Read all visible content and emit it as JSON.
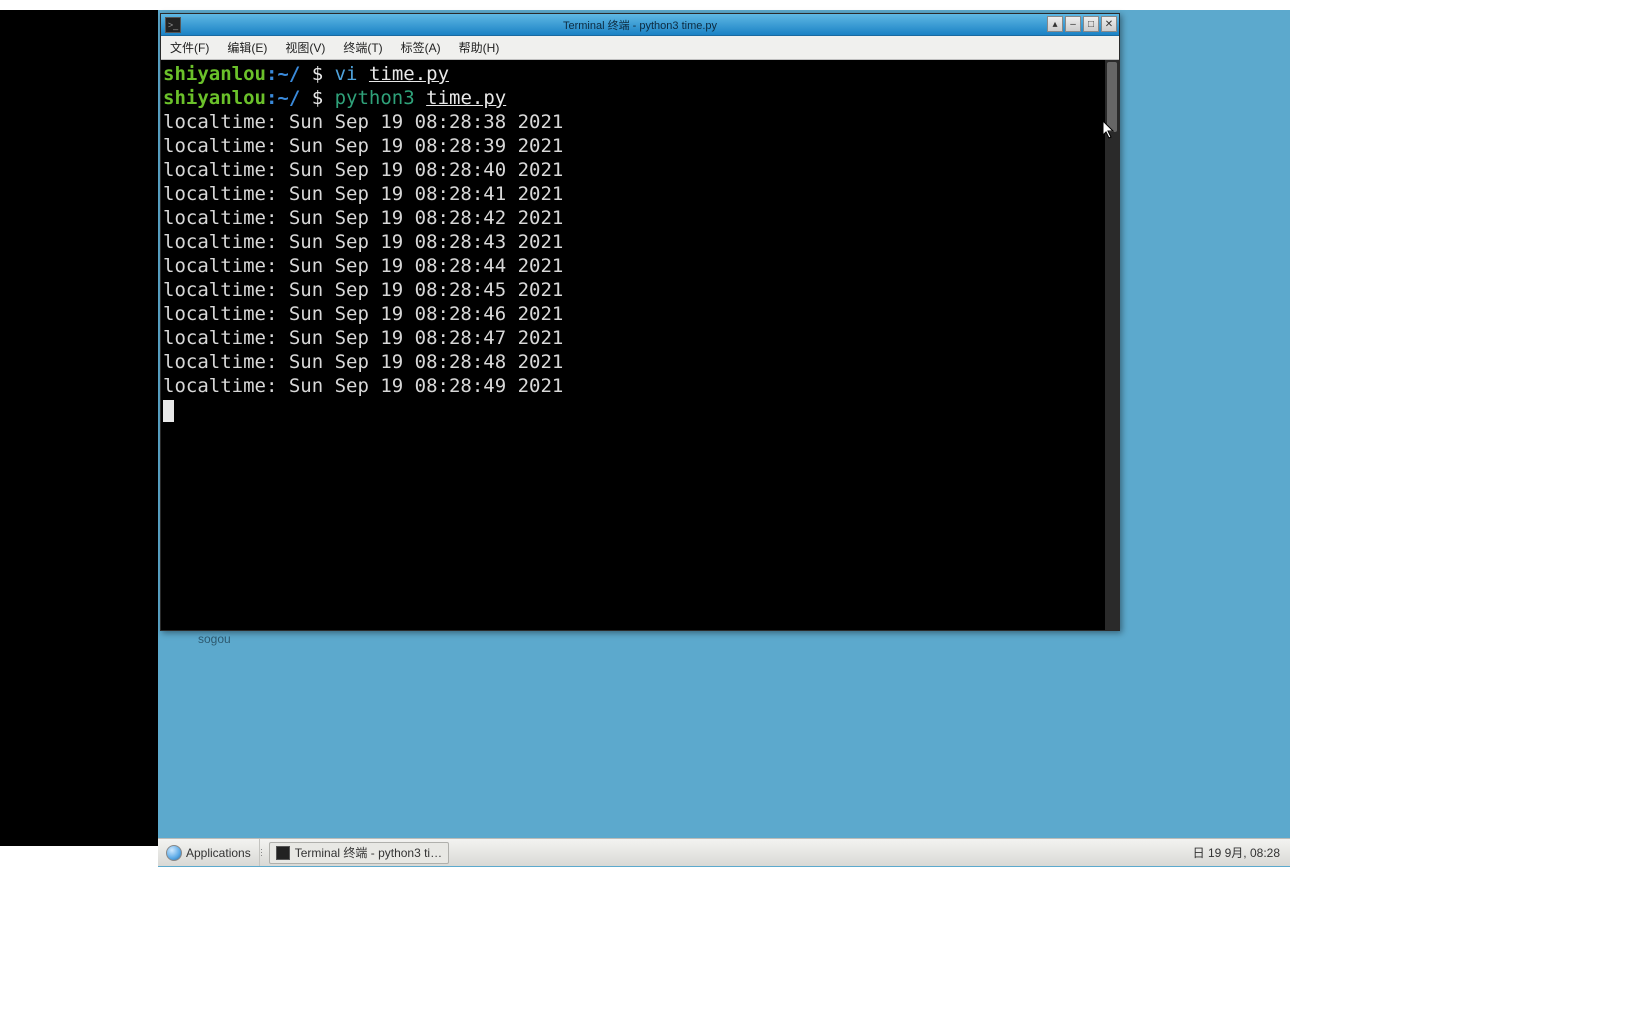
{
  "window": {
    "title": "Terminal 终端 - python3 time.py"
  },
  "menubar": {
    "file": "文件(F)",
    "edit": "编辑(E)",
    "view": "视图(V)",
    "terminal": "终端(T)",
    "tabs": "标签(A)",
    "help": "帮助(H)"
  },
  "prompt": {
    "user_host": "shiyanlou",
    "path": ":~/",
    "sep": " $ "
  },
  "commands": {
    "line1_cmd": "vi",
    "line1_arg": "time.py",
    "line2_cmd": "python3",
    "line2_arg": "time.py"
  },
  "output": [
    "localtime: Sun Sep 19 08:28:38 2021",
    "localtime: Sun Sep 19 08:28:39 2021",
    "localtime: Sun Sep 19 08:28:40 2021",
    "localtime: Sun Sep 19 08:28:41 2021",
    "localtime: Sun Sep 19 08:28:42 2021",
    "localtime: Sun Sep 19 08:28:43 2021",
    "localtime: Sun Sep 19 08:28:44 2021",
    "localtime: Sun Sep 19 08:28:45 2021",
    "localtime: Sun Sep 19 08:28:46 2021",
    "localtime: Sun Sep 19 08:28:47 2021",
    "localtime: Sun Sep 19 08:28:48 2021",
    "localtime: Sun Sep 19 08:28:49 2021"
  ],
  "desktop": {
    "sogou": "sogou"
  },
  "taskbar": {
    "applications": "Applications",
    "task_title": "Terminal 终端 - python3 ti…",
    "clock": "日 19 9月, 08:28"
  }
}
